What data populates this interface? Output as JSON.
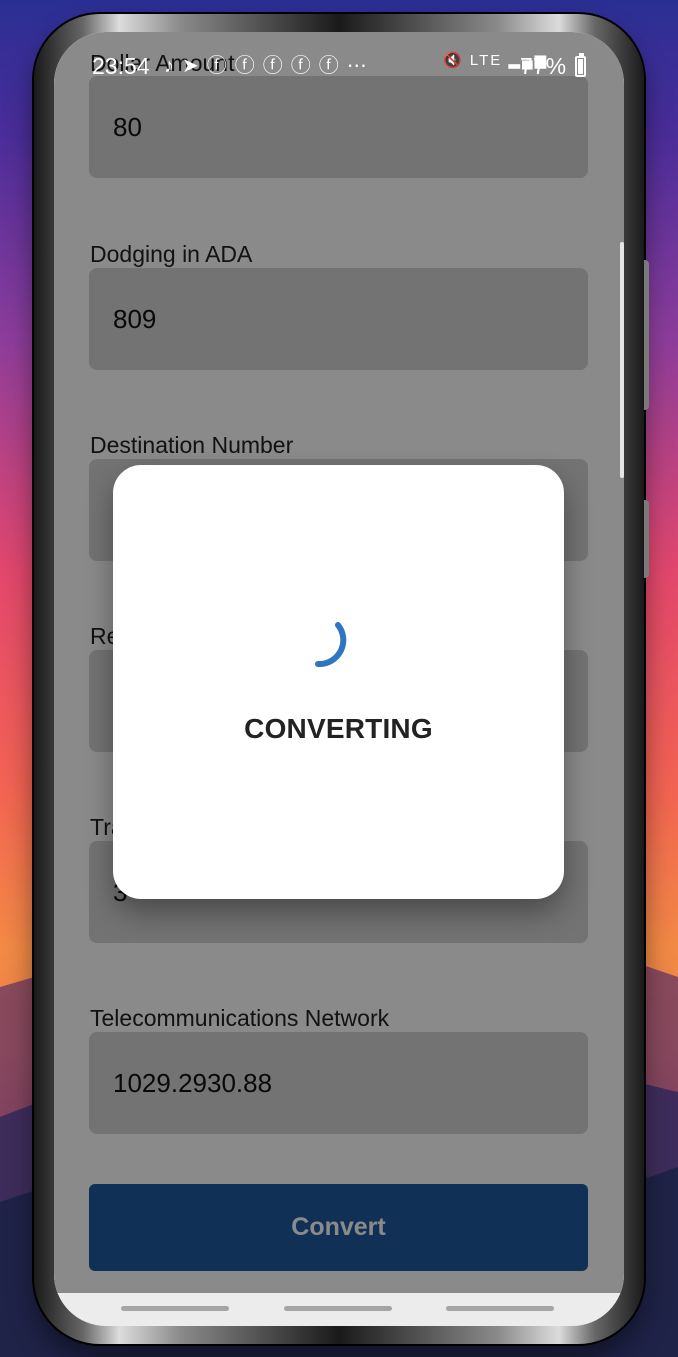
{
  "status_bar": {
    "time": "23:54",
    "left_icons": [
      "music-icon",
      "telegram-icon",
      "facebook-icon",
      "facebook-icon",
      "facebook-icon",
      "facebook-icon",
      "facebook-icon",
      "more-icon"
    ],
    "right_icons": [
      "mute-icon",
      "lte-icon",
      "signal-icon"
    ],
    "battery_percent": "77%"
  },
  "form": {
    "fields": [
      {
        "label": "Dollar Amount",
        "value": "80"
      },
      {
        "label": "Dodging in ADA",
        "value": "809"
      },
      {
        "label": "Destination Number",
        "value": ""
      },
      {
        "label": "Re",
        "value": ""
      },
      {
        "label": "Tra",
        "value": "3"
      },
      {
        "label": "Telecommunications Network",
        "value": "1029.2930.88"
      }
    ],
    "convert_button": "Convert"
  },
  "loading_modal": {
    "text": "CONVERTING",
    "spinner_color": "#2f75bf"
  },
  "colors": {
    "convert_button_background": "#1e5a9e",
    "modal_background": "#ffffff"
  }
}
